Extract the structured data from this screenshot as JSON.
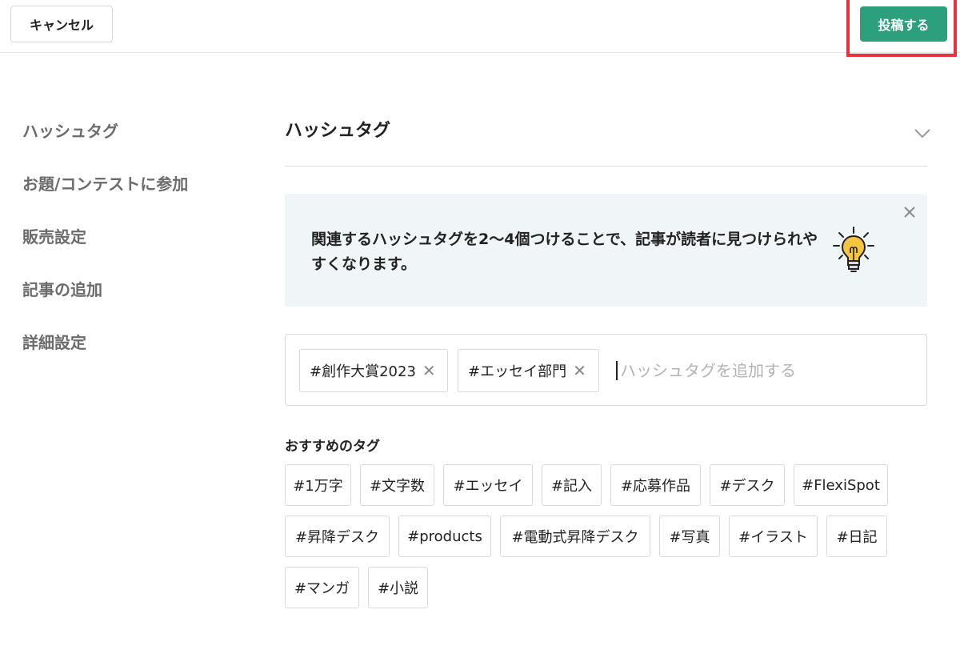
{
  "header": {
    "cancel_label": "キャンセル",
    "post_label": "投稿する",
    "post_color": "#2c9f7c",
    "highlight_color": "#e8313f"
  },
  "sidebar": {
    "items": [
      {
        "label": "ハッシュタグ"
      },
      {
        "label": "お題/コンテストに参加"
      },
      {
        "label": "販売設定"
      },
      {
        "label": "記事の追加"
      },
      {
        "label": "詳細設定"
      }
    ]
  },
  "main": {
    "section_title": "ハッシュタグ",
    "tip": {
      "text": "関連するハッシュタグを2〜4個つけることで、記事が読者に見つけられやすくなります。",
      "icon": "lightbulb-icon",
      "background": "#f0f6f7"
    },
    "selected_tags": [
      {
        "label": "#創作大賞2023"
      },
      {
        "label": "#エッセイ部門"
      }
    ],
    "input": {
      "placeholder": "ハッシュタグを追加する",
      "value": ""
    },
    "recommended": {
      "label": "おすすめのタグ",
      "tags": [
        "#1万字",
        "#文字数",
        "#エッセイ",
        "#記入",
        "#応募作品",
        "#デスク",
        "#FlexiSpot",
        "#昇降デスク",
        "#products",
        "#電動式昇降デスク",
        "#写真",
        "#イラスト",
        "#日記",
        "#マンガ",
        "#小説"
      ]
    }
  }
}
